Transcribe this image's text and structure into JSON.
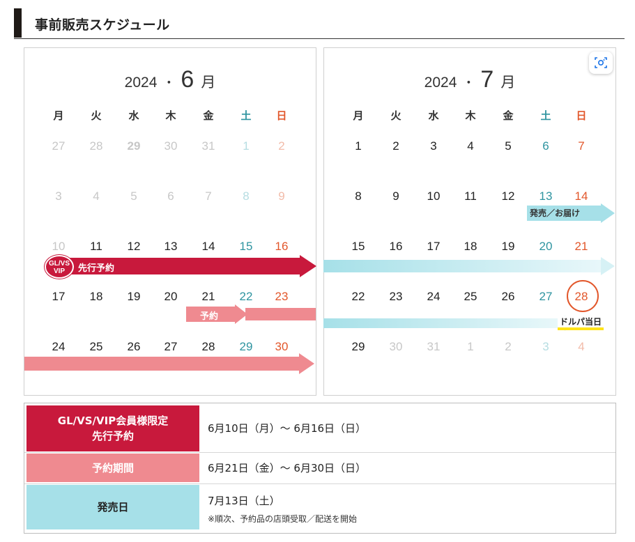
{
  "header": {
    "title": "事前販売スケジュール"
  },
  "calendar": {
    "weekdays": [
      "月",
      "火",
      "水",
      "木",
      "金",
      "土",
      "日"
    ],
    "june": {
      "year": "2024",
      "dot": "・",
      "month": "6",
      "unit": "月",
      "weeks": [
        [
          "27",
          "28",
          "29",
          "30",
          "31",
          "1",
          "2"
        ],
        [
          "3",
          "4",
          "5",
          "6",
          "7",
          "8",
          "9"
        ],
        [
          "10",
          "11",
          "12",
          "13",
          "14",
          "15",
          "16"
        ],
        [
          "17",
          "18",
          "19",
          "20",
          "21",
          "22",
          "23"
        ],
        [
          "24",
          "25",
          "26",
          "27",
          "28",
          "29",
          "30"
        ]
      ]
    },
    "july": {
      "year": "2024",
      "dot": "・",
      "month": "7",
      "unit": "月",
      "weeks": [
        [
          "1",
          "2",
          "3",
          "4",
          "5",
          "6",
          "7"
        ],
        [
          "8",
          "9",
          "10",
          "11",
          "12",
          "13",
          "14"
        ],
        [
          "15",
          "16",
          "17",
          "18",
          "19",
          "20",
          "21"
        ],
        [
          "22",
          "23",
          "24",
          "25",
          "26",
          "27",
          "28"
        ],
        [
          "29",
          "30",
          "31",
          "1",
          "2",
          "3",
          "4"
        ]
      ]
    },
    "labels": {
      "badge_line1": "GL/VS",
      "badge_line2": "VIP",
      "advance": "先行予約",
      "reserve": "予約",
      "release": "発売／お届け",
      "delivery_day": "ドルパ当日"
    },
    "colors": {
      "advance": "#c8193c",
      "reserve": "#ef8a90",
      "release": "#a6e0e8",
      "saturday": "#2e94a0",
      "sunday": "#e2572b",
      "highlight": "#ffe31a"
    },
    "camera_icon": "scan-camera-icon"
  },
  "info": {
    "rows": [
      {
        "label_line1": "GL/VS/VIP会員様限定",
        "label_line2": "先行予約",
        "value": "6月10日（月）～ 6月16日（日）"
      },
      {
        "label": "予約期間",
        "value": "6月21日（金）～ 6月30日（日）"
      },
      {
        "label": "発売日",
        "value": "7月13日（土）",
        "note": "※順次、予約品の店頭受取／配送を開始"
      }
    ]
  }
}
